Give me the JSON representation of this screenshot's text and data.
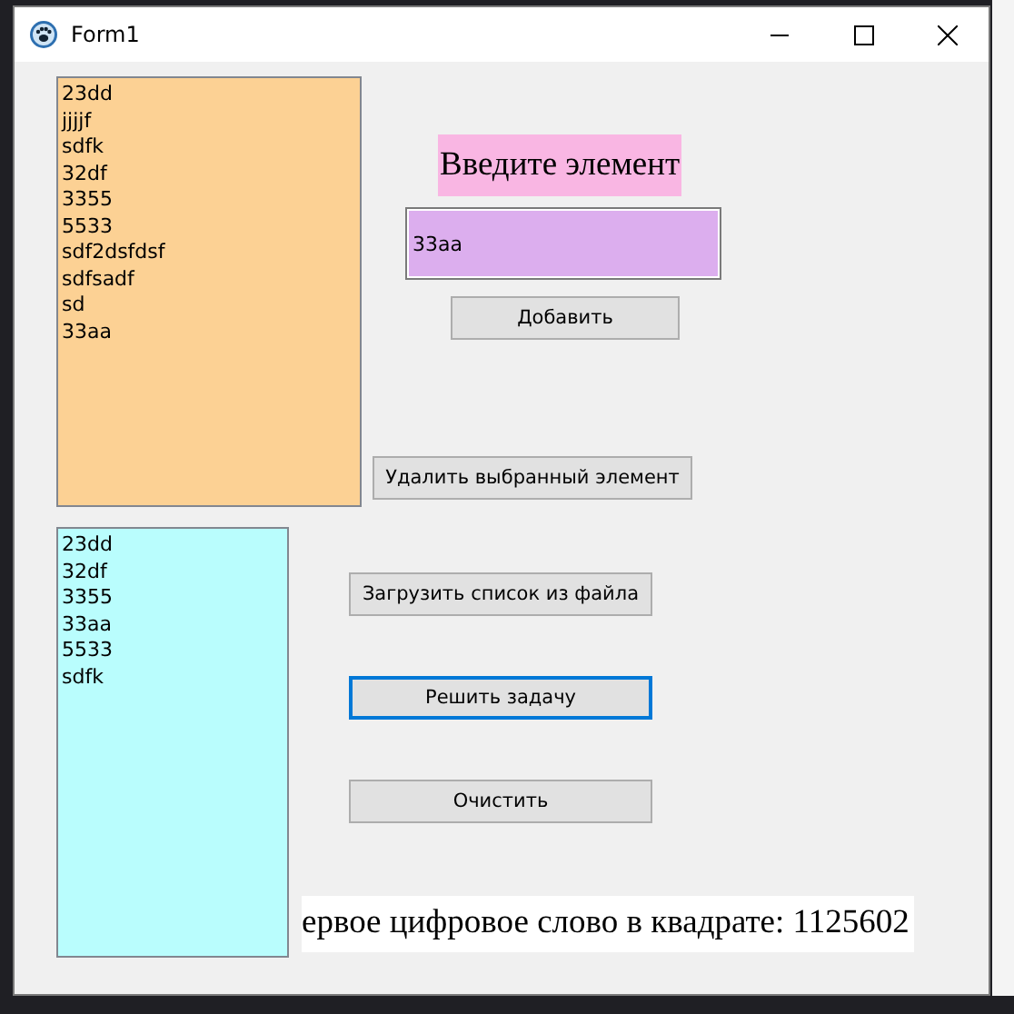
{
  "window": {
    "title": "Form1"
  },
  "source_list": {
    "items": [
      "23dd",
      "jjjjf",
      "sdfk",
      "32df",
      "3355",
      "5533",
      "sdf2dsfdsf",
      "sdfsadf",
      "sd",
      "33aa"
    ]
  },
  "prompt_label": "Введите элемент",
  "input": {
    "value": "33aa"
  },
  "add_button": {
    "label": "Добавить",
    "focused": false
  },
  "remove_button": {
    "label": "Удалить выбранный элемент",
    "focused": false
  },
  "result_list": {
    "items": [
      "23dd",
      "32df",
      "3355",
      "33aa",
      "5533",
      "sdfk"
    ]
  },
  "load_button": {
    "label": "Загрузить список из файла",
    "focused": false
  },
  "solve_button": {
    "label": "Решить задачу",
    "focused": true
  },
  "clear_button": {
    "label": "Очистить",
    "focused": false
  },
  "result_label": "ервое цифровое слово в квадрате: 1125602"
}
